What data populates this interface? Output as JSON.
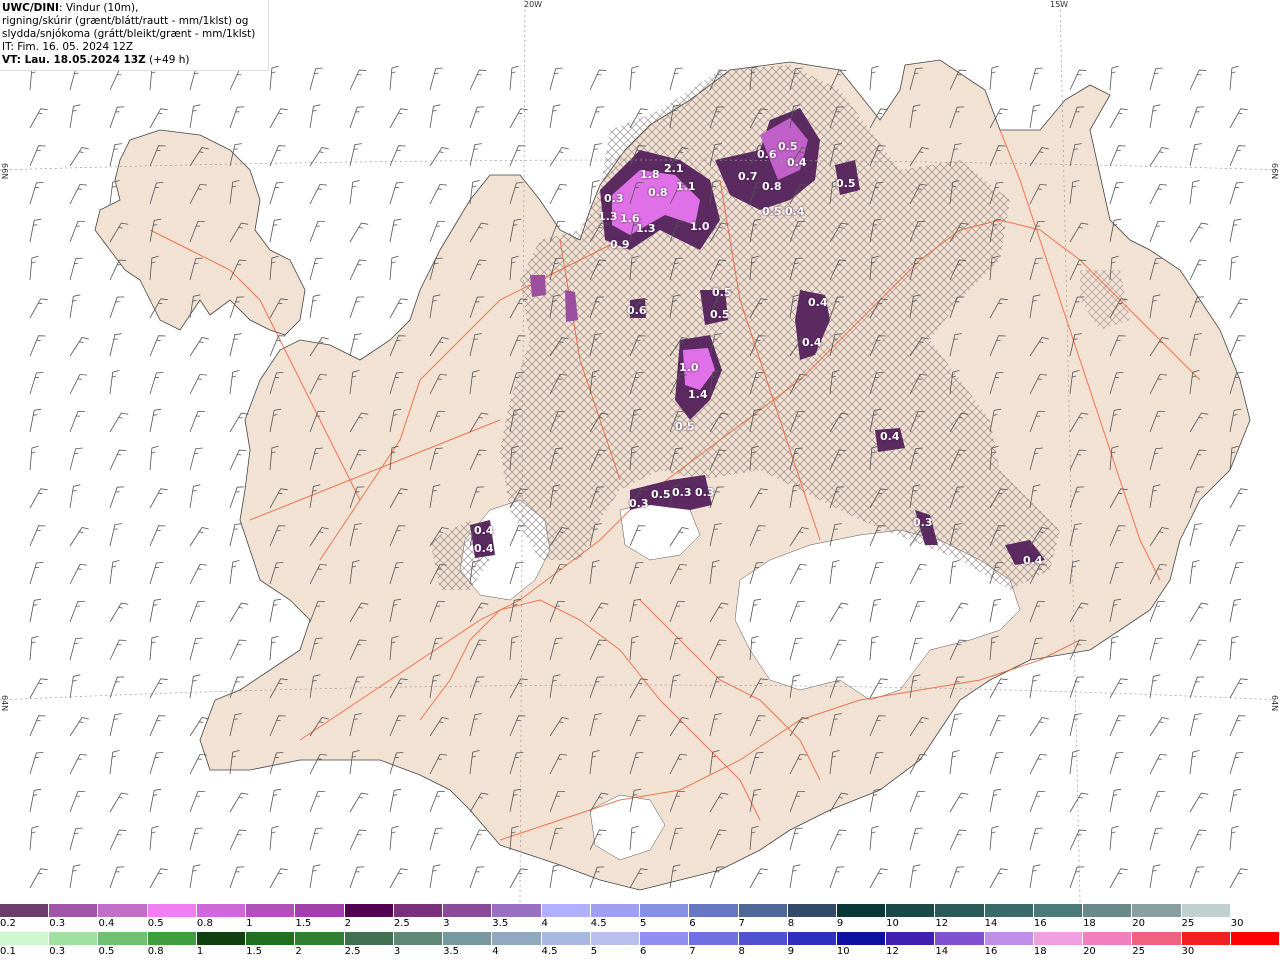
{
  "header": {
    "title_bold": "UWC/DINI",
    "title_rest": ": Vindur (10m),",
    "line2": "rigning/skúrir (grænt/blátt/rautt - mm/1klst) og",
    "line3": "slydda/snjókoma (grátt/bleikt/grænt - mm/1klst)",
    "line4": "IT: Fim. 16. 05. 2024 12Z",
    "line5_bold": "VT: Lau. 18.05.2024 13Z",
    "line5_rest": " (+49 h)"
  },
  "graticule": {
    "lon_top": [
      "20W",
      "15W"
    ],
    "lat_left": [
      "66N",
      "64N"
    ],
    "lat_right": [
      "66N",
      "64N"
    ]
  },
  "precip_labels": [
    "0.3",
    "1.8",
    "2.1",
    "1.1",
    "0.8",
    "1.3",
    "1.6",
    "1.3",
    "0.9",
    "1.0",
    "0.7",
    "0.8",
    "0.5",
    "0.4",
    "0.5",
    "0.6",
    "0.4",
    "0.5",
    "0.5",
    "0.4",
    "0.5",
    "0.6",
    "0.4",
    "1.0",
    "1.4",
    "0.5",
    "0.5",
    "0.3",
    "0.3",
    "0.4",
    "0.3",
    "0.4",
    "0.4",
    "0.4",
    "0.3"
  ],
  "colors": {
    "land": "#f2e2d4",
    "roads": "#e8623a",
    "sea": "#ffffff",
    "sleet_dark": "#5a2a60",
    "sleet_mid": "#9c4fa0",
    "sleet_light": "#e070e8",
    "hatch": "#7a6a6a"
  },
  "scale_top": {
    "ticks": [
      "0.2",
      "0.3",
      "0.4",
      "0.5",
      "0.8",
      "1",
      "1.5",
      "2",
      "2.5",
      "3",
      "3.5",
      "4",
      "4.5",
      "5",
      "6",
      "7",
      "8",
      "9",
      "10",
      "12",
      "14",
      "16",
      "18",
      "20",
      "25",
      "30"
    ],
    "colors": [
      "#6a3d6a",
      "#a055a8",
      "#c070c8",
      "#f080f0",
      "#d068d8",
      "#b050b8",
      "#a040a8",
      "#500050",
      "#7a307a",
      "#8a4a9a",
      "#9a70c0",
      "#b0b0ff",
      "#a0a0f0",
      "#8890e0",
      "#6878c0",
      "#506898",
      "#304a68",
      "#083838",
      "#184848",
      "#2a5a5a",
      "#3a6a6a",
      "#4a7a7a",
      "#6a8a8a",
      "#8aa0a0",
      "#c0d0d0",
      "#ffffff"
    ]
  },
  "scale_bottom": {
    "ticks": [
      "0.1",
      "0.3",
      "0.5",
      "0.8",
      "1",
      "1.5",
      "2",
      "2.5",
      "3",
      "3.5",
      "4",
      "4.5",
      "5",
      "6",
      "7",
      "8",
      "9",
      "10",
      "12",
      "14",
      "16",
      "18",
      "20",
      "25",
      "30"
    ],
    "colors": [
      "#d0f8d0",
      "#a0e0a0",
      "#70c070",
      "#40a040",
      "#104010",
      "#207020",
      "#308030",
      "#407050",
      "#608878",
      "#7898a0",
      "#90a8c0",
      "#a8b8e0",
      "#b8c0f0",
      "#9090f0",
      "#7070e0",
      "#5050d0",
      "#3030c0",
      "#1010a0",
      "#4020b0",
      "#8050d0",
      "#c090e8",
      "#f0a0e0",
      "#f080c0",
      "#f06080",
      "#f02020",
      "#ff0000"
    ]
  }
}
